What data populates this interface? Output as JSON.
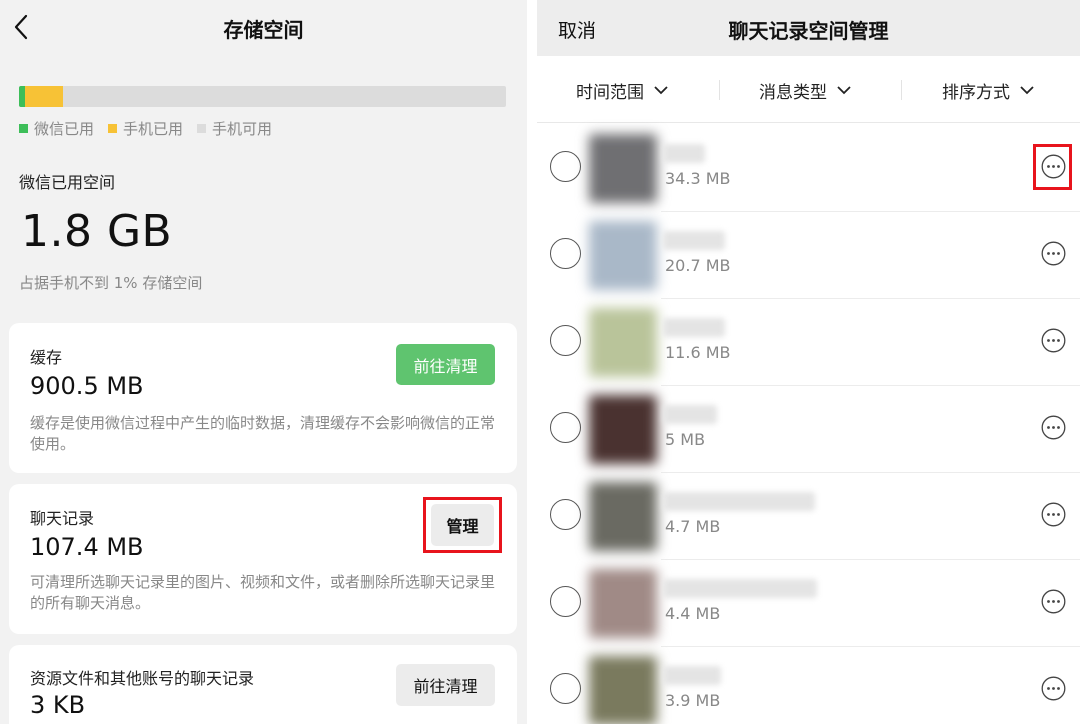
{
  "left": {
    "title": "存储空间",
    "bar_segments": [
      {
        "name": "wechat-used",
        "fraction": 0.012,
        "color": "#3dbe59"
      },
      {
        "name": "phone-used",
        "fraction": 0.079,
        "color": "#f7c236"
      }
    ],
    "bar_color": "#dcdcdc",
    "legend": [
      {
        "label": "微信已用",
        "color": "#3dbe59"
      },
      {
        "label": "手机已用",
        "color": "#f7c236"
      },
      {
        "label": "手机可用",
        "color": "#dcdcdc"
      }
    ],
    "used_label": "微信已用空间",
    "used_value": "1.8 GB",
    "used_sub": "占据手机不到 1% 存储空间",
    "cache": {
      "label": "缓存",
      "value": "900.5 MB",
      "desc": "缓存是使用微信过程中产生的临时数据，清理缓存不会影响微信的正常使用。",
      "button": "前往清理"
    },
    "chat": {
      "label": "聊天记录",
      "value": "107.4 MB",
      "desc": "可清理所选聊天记录里的图片、视频和文件，或者删除所选聊天记录里的所有聊天消息。",
      "button": "管理"
    },
    "resources": {
      "label": "资源文件和其他账号的聊天记录",
      "value": "3 KB",
      "button": "前往清理"
    }
  },
  "right": {
    "cancel": "取消",
    "title": "聊天记录空间管理",
    "filters": [
      {
        "label": "时间范围"
      },
      {
        "label": "消息类型"
      },
      {
        "label": "排序方式"
      }
    ],
    "rows": [
      {
        "size": "34.3 MB",
        "avatar_color": "#6f6f72"
      },
      {
        "size": "20.7 MB",
        "avatar_color": "#a9b8c8"
      },
      {
        "size": "11.6 MB",
        "avatar_color": "#b9c49a"
      },
      {
        "size": "5 MB",
        "avatar_color": "#4a3230"
      },
      {
        "size": "4.7 MB",
        "avatar_color": "#6a6a62"
      },
      {
        "size": "4.4 MB",
        "avatar_color": "#a08a86"
      },
      {
        "size": "3.9 MB",
        "avatar_color": "#7a7a5e"
      }
    ]
  },
  "colors": {
    "highlight": "#e8141c",
    "green_button": "#5fc46f"
  }
}
